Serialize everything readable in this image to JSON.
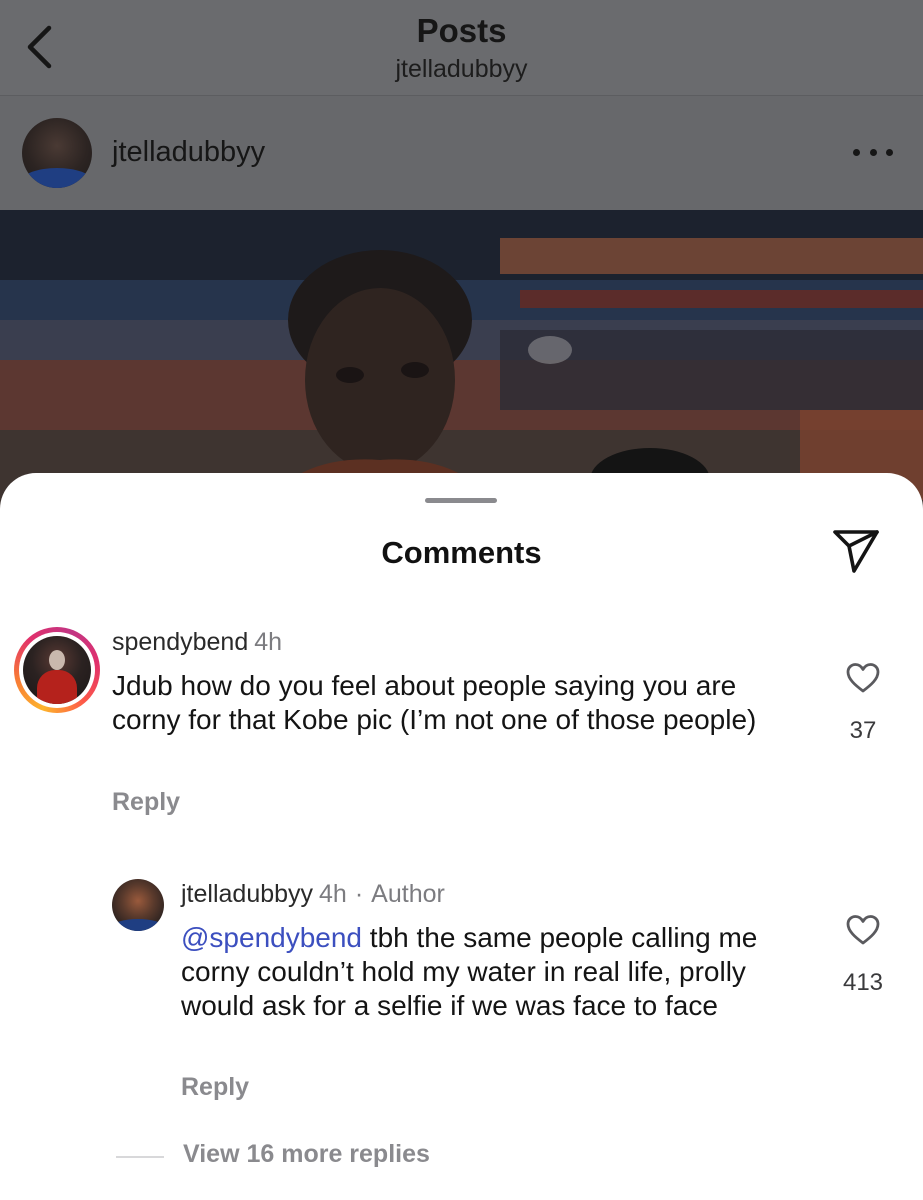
{
  "header": {
    "title": "Posts",
    "subtitle": "jtelladubbyy"
  },
  "post": {
    "username": "jtelladubbyy"
  },
  "sheet": {
    "title": "Comments"
  },
  "comments": [
    {
      "username": "spendybend",
      "time": "4h",
      "text": "Jdub how do you feel about people saying you are corny for that Kobe pic (I’m not one of those people)",
      "likes": "37",
      "reply_label": "Reply"
    }
  ],
  "replies": [
    {
      "username": "jtelladubbyy",
      "time": "4h",
      "separator": "·",
      "role": "Author",
      "mention": "@spendybend",
      "text": " tbh the same people calling me corny couldn’t hold my water in real life, prolly would ask for a selfie if we was face to face",
      "likes": "413",
      "reply_label": "Reply"
    }
  ],
  "more_replies_label": "View 16 more replies",
  "colors": {
    "mention": "#3c4fbf",
    "dim_overlay": "#636467",
    "story_ring": [
      "#fdb42c",
      "#e1306c",
      "#c13584"
    ]
  },
  "icons": {
    "back": "chevron-left-icon",
    "more": "ellipsis-icon",
    "share": "paper-plane-icon",
    "like": "heart-outline-icon"
  }
}
